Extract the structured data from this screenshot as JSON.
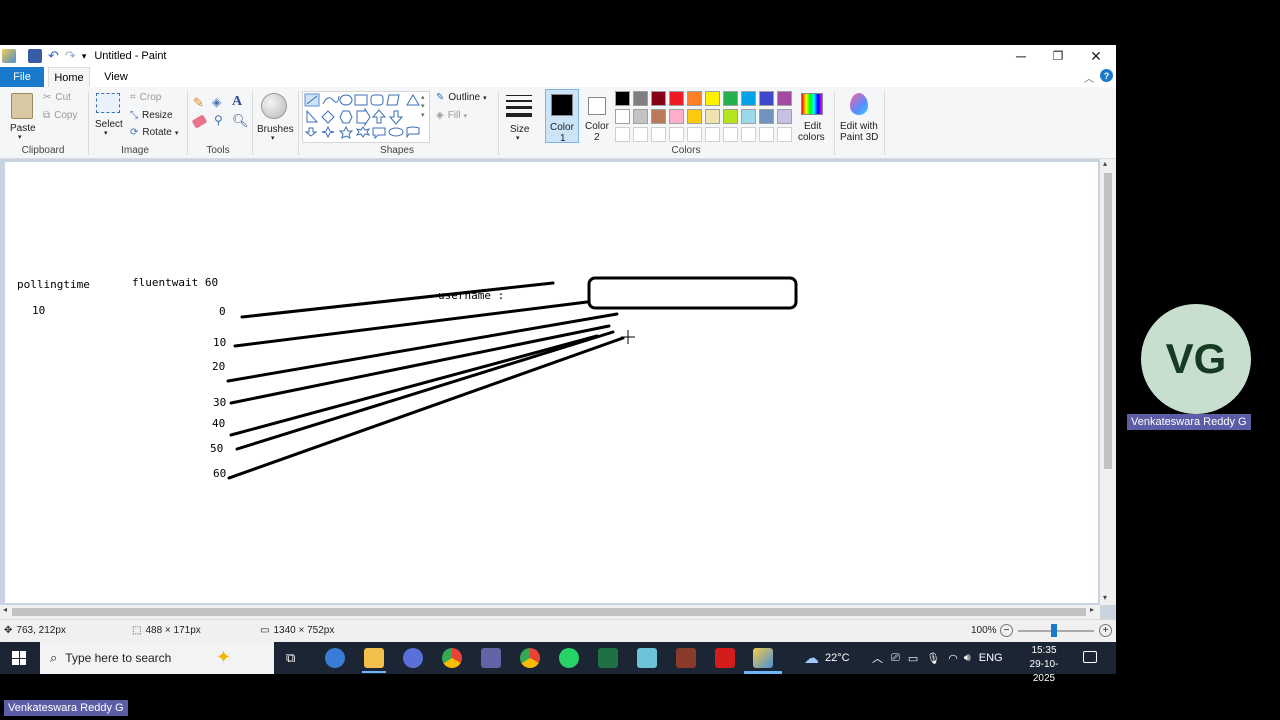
{
  "window": {
    "title": "Untitled - Paint",
    "tabs": [
      "File",
      "Home",
      "View"
    ]
  },
  "ribbon": {
    "clipboard": {
      "paste": "Paste",
      "cut": "Cut",
      "copy": "Copy",
      "label": "Clipboard"
    },
    "image": {
      "select": "Select",
      "crop": "Crop",
      "resize": "Resize",
      "rotate": "Rotate",
      "label": "Image"
    },
    "tools": {
      "label": "Tools"
    },
    "brushes": "Brushes",
    "shapes": {
      "outline": "Outline",
      "fill": "Fill",
      "label": "Shapes"
    },
    "size": "Size",
    "color1": {
      "line1": "Color",
      "line2": "1"
    },
    "color2": {
      "line1": "Color",
      "line2": "2"
    },
    "colors_label": "Colors",
    "edit_colors": {
      "line1": "Edit",
      "line2": "colors"
    },
    "paint3d": {
      "line1": "Edit with",
      "line2": "Paint 3D"
    },
    "palette_row1": [
      "#000000",
      "#7f7f7f",
      "#880015",
      "#ed1c24",
      "#ff7f27",
      "#fff200",
      "#22b14c",
      "#00a2e8",
      "#3f48cc",
      "#a349a4"
    ],
    "palette_row2": [
      "#ffffff",
      "#c3c3c3",
      "#b97a57",
      "#ffaec9",
      "#ffc90e",
      "#efe4b0",
      "#b5e61d",
      "#99d9ea",
      "#7092be",
      "#c8bfe7"
    ]
  },
  "canvas": {
    "pollingtime_label": "pollingtime",
    "pollingtime_value": "10",
    "fluentwait_label": "fluentwait 60",
    "username_label": "username :",
    "ticks": [
      "0",
      "10",
      "20",
      "30",
      "40",
      "50",
      "60"
    ]
  },
  "statusbar": {
    "cursor_pos": "763, 212px",
    "selection_size": "488 × 171px",
    "image_size": "1340 × 752px",
    "zoom": "100%"
  },
  "taskbar": {
    "search_placeholder": "Type here to search",
    "weather": "22°C",
    "lang": "ENG",
    "time": "15:35",
    "date": "29-10-2025"
  },
  "participant": {
    "initials": "VG",
    "name": "Venkateswara Reddy G"
  }
}
